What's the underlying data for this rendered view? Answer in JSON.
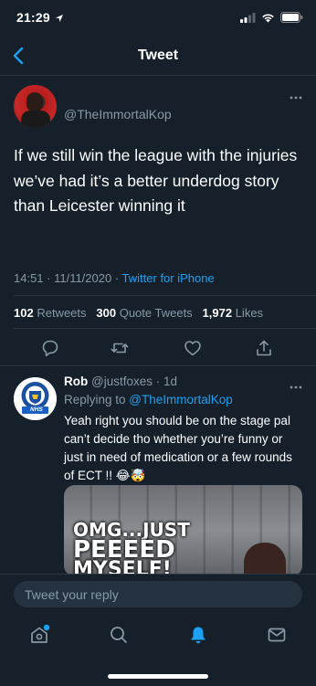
{
  "status_bar": {
    "time": "21:29"
  },
  "header": {
    "title": "Tweet"
  },
  "tweet": {
    "handle": "@TheImmortalKop",
    "text": "If we still win the league with the injuries we’ve had it’s a better underdog story than Leicester winning it",
    "timestamp": "14:51 · 11/11/2020 · ",
    "source": "Twitter for iPhone",
    "retweets_count": "102",
    "retweets_label": "Retweets",
    "quote_count": "300",
    "quote_label": "Quote Tweets",
    "likes_count": "1,972",
    "likes_label": "Likes"
  },
  "reply": {
    "name": "Rob",
    "handle_time": "@justfoxes · 1d",
    "replying_prefix": "Replying to ",
    "replying_to": "@TheImmortalKop",
    "text": "Yeah right you should be on the stage pal can’t decide tho whether you’re funny or just in need of medication or a few rounds of ECT !! 😂🤯",
    "avatar_badge": "NHS",
    "media_caption": [
      "OMG...JUST",
      "PEEEED",
      "MYSELF!"
    ]
  },
  "compose": {
    "placeholder": "Tweet your reply"
  },
  "tabbar": {
    "items": [
      "home",
      "search",
      "notifications",
      "messages"
    ]
  },
  "colors": {
    "background": "#15202b",
    "accent": "#1da1f2",
    "muted": "#8899a6",
    "divider": "#2a3744"
  }
}
